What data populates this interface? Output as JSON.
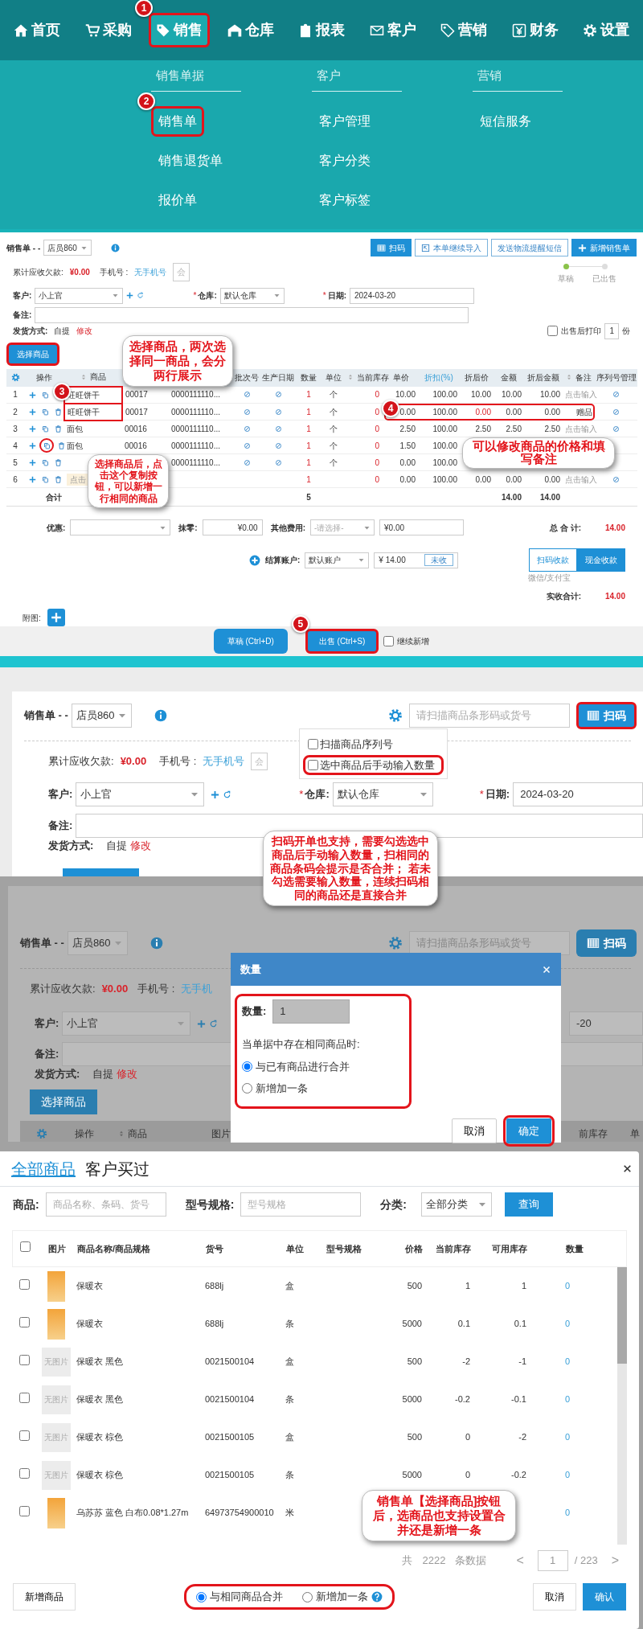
{
  "top_nav": {
    "items": [
      {
        "label": "首页",
        "selected": false,
        "highlighted": false
      },
      {
        "label": "采购",
        "selected": false,
        "highlighted": false
      },
      {
        "label": "销售",
        "selected": true,
        "highlighted": true,
        "marker": "1"
      },
      {
        "label": "仓库",
        "selected": false,
        "highlighted": false
      },
      {
        "label": "报表",
        "selected": false,
        "highlighted": false
      },
      {
        "label": "客户",
        "selected": false,
        "highlighted": false
      },
      {
        "label": "营销",
        "selected": false,
        "highlighted": false
      },
      {
        "label": "财务",
        "selected": false,
        "highlighted": false
      },
      {
        "label": "设置",
        "selected": false,
        "highlighted": false
      }
    ]
  },
  "sales_menu": {
    "columns": [
      {
        "title": "销售单据",
        "items": [
          {
            "label": "销售单",
            "highlighted": true,
            "marker": "2"
          },
          {
            "label": "销售退货单",
            "highlighted": false
          },
          {
            "label": "报价单",
            "highlighted": false
          }
        ]
      },
      {
        "title": "客户",
        "items": [
          {
            "label": "客户管理",
            "highlighted": false
          },
          {
            "label": "客户分类",
            "highlighted": false
          },
          {
            "label": "客户标签",
            "highlighted": false
          }
        ]
      },
      {
        "title": "营销",
        "items": [
          {
            "label": "短信服务",
            "highlighted": false
          }
        ]
      }
    ]
  },
  "sales_order": {
    "title": "销售单 - -",
    "staff": "店员860",
    "buttons": [
      {
        "kind": "primary",
        "label": "扫码"
      },
      {
        "kind": "outline",
        "label": "本单继续导入"
      },
      {
        "kind": "outline",
        "label": "发送物流提醒短信"
      },
      {
        "kind": "primary",
        "label": "新增销售单"
      }
    ],
    "steps": [
      {
        "label": "草稿",
        "done": true
      },
      {
        "label": "已出售",
        "done": false
      }
    ],
    "debt_label": "累计应收欠款:",
    "debt": "¥0.00",
    "phone_label": "手机号 :",
    "phone": "无手机号",
    "member": "会",
    "customer_label": "客户:",
    "customer": "小上官",
    "required_mark": "*",
    "warehouse_label": "仓库:",
    "warehouse": "默认仓库",
    "date_label": "日期:",
    "date": "2024-03-20",
    "note_label": "备注:",
    "shipping_label": "发货方式:",
    "shipping": "自提",
    "shipping_edit": "修改",
    "print_after": {
      "label": "出售后打印",
      "checked": false,
      "copies": "1",
      "unit": "份"
    },
    "select_button": {
      "label": "选择商品",
      "highlighted": true
    },
    "columns": [
      {
        "label": "操作",
        "kind": "plain"
      },
      {
        "label": "商品",
        "kind": "sortable"
      },
      {
        "label": "批次号",
        "kind": "plain"
      },
      {
        "label": "生产日期",
        "kind": "plain"
      },
      {
        "label": "数量",
        "kind": "plain"
      },
      {
        "label": "单位",
        "kind": "plain"
      },
      {
        "label": "当前库存",
        "kind": "sortable"
      },
      {
        "label": "单价",
        "kind": "plain"
      },
      {
        "label": "折扣(%)",
        "kind": "link"
      },
      {
        "label": "折后价",
        "kind": "plain"
      },
      {
        "label": "金额",
        "kind": "plain"
      },
      {
        "label": "折后金额",
        "kind": "plain"
      },
      {
        "label": "备注",
        "kind": "sortable"
      },
      {
        "label": "序列号管理",
        "kind": "plain"
      }
    ],
    "rows": [
      {
        "index": "1",
        "product": "旺旺饼干",
        "code": "00017",
        "barcode": "0000111110...",
        "quantity": "1",
        "unit": "个",
        "stock": "0",
        "price": "10.00",
        "discount": "100.00",
        "discounted_price": "10.00",
        "amount": "10.00",
        "discounted_amount": "10.00",
        "note": "点击输入",
        "note_placeholder": true,
        "price_changed": false,
        "product_highlighted": true,
        "pricing_highlighted": false,
        "copy_highlighted": false,
        "product_marker": "3"
      },
      {
        "index": "2",
        "product": "旺旺饼干",
        "code": "00017",
        "barcode": "0000111110...",
        "quantity": "1",
        "unit": "个",
        "stock": "0",
        "price": "0.00",
        "discount": "100.00",
        "discounted_price": "0.00",
        "amount": "0.00",
        "discounted_amount": "0.00",
        "note": "赠品",
        "note_placeholder": false,
        "price_changed": true,
        "product_highlighted": true,
        "pricing_highlighted": true,
        "copy_highlighted": false,
        "pricing_marker": "4"
      },
      {
        "index": "3",
        "product": "面包",
        "code": "00016",
        "barcode": "0000111110...",
        "quantity": "1",
        "unit": "个",
        "stock": "0",
        "price": "2.50",
        "discount": "100.00",
        "discounted_price": "2.50",
        "amount": "2.50",
        "discounted_amount": "2.50",
        "note": "点击输入",
        "note_placeholder": true,
        "price_changed": false,
        "product_highlighted": false,
        "pricing_highlighted": false,
        "copy_highlighted": false
      },
      {
        "index": "4",
        "product": "面包",
        "code": "00016",
        "barcode": "0000111110...",
        "quantity": "1",
        "unit": "个",
        "stock": "0",
        "price": "1.50",
        "discount": "100.00",
        "price_changed": false,
        "product_highlighted": false,
        "pricing_highlighted": false,
        "copy_highlighted": true
      },
      {
        "index": "5",
        "barcode": "0000111110...",
        "quantity": "1",
        "unit": "个",
        "stock": "0",
        "price": "0.00",
        "discount": "100.00",
        "price_changed": false,
        "product_highlighted": false,
        "pricing_highlighted": false,
        "copy_highlighted": false
      },
      {
        "index": "6",
        "product_placeholder": "点击",
        "quantity": "1",
        "stock": "0",
        "price": "0.00",
        "discount": "100.00",
        "discounted_price": "0.00",
        "amount": "0.00",
        "discounted_amount": "0.00",
        "note": "点击输入",
        "note_placeholder": true,
        "price_changed": false,
        "product_highlighted": false,
        "pricing_highlighted": false,
        "copy_highlighted": false
      }
    ],
    "total": {
      "label": "合计",
      "quantity": "5",
      "amount": "14.00",
      "discounted_amount": "14.00"
    },
    "discount_label": "优惠:",
    "rounding_label": "抹零:",
    "rounding": "¥0.00",
    "other_fee_label": "其他费用:",
    "other_fee_placeholder": "-请选择-",
    "other_fee": "¥0.00",
    "total_label": "总 合 计:",
    "total_value": "14.00",
    "account_label": "结算账户:",
    "account": "默认账户",
    "paid": "¥ 14.00",
    "unpaid_button": "未收",
    "payment_tabs": [
      {
        "label": "扫码收款",
        "selected": false
      },
      {
        "label": "现金收款",
        "selected": true
      }
    ],
    "payment_hint": "微信/支付宝",
    "received_label": "实收合计:",
    "received": "14.00",
    "attachment_label": "附图:"
  },
  "bottom_bar": {
    "buttons": [
      {
        "label": "草稿 (Ctrl+D)",
        "highlighted": false
      },
      {
        "label": "出售 (Ctrl+S)",
        "highlighted": true,
        "marker": "5"
      }
    ],
    "continue": {
      "label": "继续新增",
      "checked": false
    }
  },
  "scan_view": {
    "title": "销售单 - -",
    "staff": "店员860",
    "scan_placeholder": "请扫描商品条形码或货号",
    "scan_button": {
      "label": "扫码",
      "highlighted": true
    },
    "settings_menu": [
      {
        "label": "扫描商品序列号",
        "checked": false,
        "highlighted": false
      },
      {
        "label": "选中商品后手动输入数量",
        "checked": false,
        "highlighted": true
      }
    ],
    "debt_label": "累计应收欠款:",
    "debt": "¥0.00",
    "phone_label": "手机号 :",
    "phone": "无手机号",
    "member": "会",
    "customer_label": "客户:",
    "customer": "小上官",
    "required_mark": "*",
    "warehouse_label": "仓库:",
    "warehouse": "默认仓库",
    "date_label": "日期:",
    "date": "2024-03-20",
    "note_label": "备注:",
    "shipping_label": "发货方式:",
    "shipping": "自提",
    "shipping_edit": "修改"
  },
  "quantity_view": {
    "title": "销售单 - -",
    "staff": "店员860",
    "scan_placeholder": "请扫描商品条形码或货号",
    "scan_button": "扫码",
    "debt_label": "累计应收欠款:",
    "debt": "¥0.00",
    "phone_label": "手机号 :",
    "phone": "无手机",
    "customer_label": "客户:",
    "customer": "小上官",
    "date_tail": "-20",
    "note_label": "备注:",
    "shipping_label": "发货方式:",
    "shipping": "自提",
    "shipping_edit": "修改",
    "select_button": "选择商品",
    "columns": [
      {
        "label": "操作",
        "kind": "plain"
      },
      {
        "label": "商品",
        "kind": "sortable"
      },
      {
        "label": "图片",
        "kind": "plain"
      }
    ],
    "columns_right": [
      "前库存",
      "单"
    ],
    "dialog": {
      "title": "数量",
      "quantity_label": "数量:",
      "quantity": "1",
      "prompt": "当单据中存在相同商品时:",
      "options": [
        {
          "label": "与已有商品进行合并",
          "selected": true
        },
        {
          "label": "新增加一条",
          "selected": false
        }
      ],
      "options_highlighted": true,
      "buttons": [
        {
          "label": "取消",
          "kind": "secondary",
          "highlighted": false
        },
        {
          "label": "确定",
          "kind": "primary",
          "highlighted": true
        }
      ]
    }
  },
  "product_picker": {
    "tabs": [
      {
        "label": "全部商品",
        "selected": true
      },
      {
        "label": "客户买过",
        "selected": false
      }
    ],
    "filters": {
      "product_label": "商品:",
      "product_placeholder": "商品名称、条码、货号",
      "spec_label": "型号规格:",
      "spec_placeholder": "型号规格",
      "category_label": "分类:",
      "category": "全部分类",
      "search_button": "查询"
    },
    "select_all_checked": false,
    "columns": [
      "图片",
      "商品名称/商品规格",
      "货号",
      "单位",
      "型号规格",
      "价格",
      "当前库存",
      "可用库存",
      "数量"
    ],
    "rows": [
      {
        "kind": "photo",
        "name": "保暖衣",
        "code": "688lj",
        "unit": "盒",
        "price": "500",
        "stock": "1",
        "available": "1",
        "quantity": "0",
        "checked": false
      },
      {
        "kind": "photo",
        "name": "保暖衣",
        "code": "688lj",
        "unit": "条",
        "price": "5000",
        "stock": "0.1",
        "available": "0.1",
        "quantity": "0",
        "checked": false
      },
      {
        "kind": "none",
        "image_text": "无图片",
        "name": "保暖衣  黑色",
        "code": "0021500104",
        "unit": "盒",
        "price": "500",
        "stock": "-2",
        "available": "-1",
        "quantity": "0",
        "checked": false
      },
      {
        "kind": "none",
        "image_text": "无图片",
        "name": "保暖衣  黑色",
        "code": "0021500104",
        "unit": "条",
        "price": "5000",
        "stock": "-0.2",
        "available": "-0.1",
        "quantity": "0",
        "checked": false
      },
      {
        "kind": "none",
        "image_text": "无图片",
        "name": "保暖衣  棕色",
        "code": "0021500105",
        "unit": "盒",
        "price": "500",
        "stock": "0",
        "available": "-2",
        "quantity": "0",
        "checked": false
      },
      {
        "kind": "none",
        "image_text": "无图片",
        "name": "保暖衣  棕色",
        "code": "0021500105",
        "unit": "条",
        "price": "5000",
        "stock": "0",
        "available": "-0.2",
        "quantity": "0",
        "checked": false
      },
      {
        "kind": "photo",
        "name": "乌苏苏 蓝色 白布0.08*1.27m",
        "code": "64973754900010",
        "unit": "米",
        "quantity": "0",
        "checked": false
      }
    ],
    "pagination": {
      "total_prefix": "共",
      "total": "2222",
      "total_suffix": "条数据",
      "prev": "<",
      "page": "1",
      "pages": "/ 223",
      "next": ">"
    },
    "add_button": "新增商品",
    "merge_options": [
      {
        "label": "与相同商品合并",
        "selected": true,
        "help": false
      },
      {
        "label": "新增加一条",
        "selected": false,
        "help": true
      }
    ],
    "merge_highlighted": true,
    "buttons": [
      {
        "label": "取消",
        "kind": "secondary"
      },
      {
        "label": "确认",
        "kind": "primary"
      }
    ]
  },
  "callouts": [
    {
      "text": "选择商品，两次选择同一商品，会分两行展示"
    },
    {
      "text": "选择商品后，点击这个复制按钮，可以新增一行相同的商品"
    },
    {
      "text": "可以修改商品的价格和填写备注"
    },
    {
      "text": "扫码开单也支持，需要勾选选中商品后手动输入数量，扫相同的商品条码会提示是否合并； 若未勾选需要输入数量，连续扫码相同的商品还是直接合并"
    },
    {
      "text": "销售单【选择商品]按钮后，选商品也支持设置合并还是新增一条"
    }
  ]
}
